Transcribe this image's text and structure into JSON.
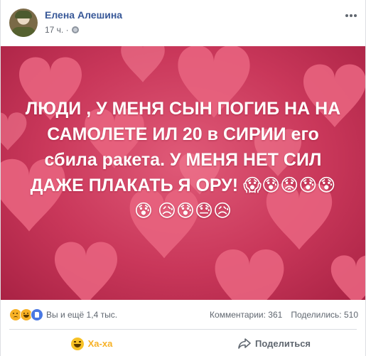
{
  "post": {
    "author": "Елена Алешина",
    "time": "17 ч. ·",
    "text": "ЛЮДИ , У МЕНЯ СЫН ПОГИБ НА НА САМОЛЕТЕ ИЛ 20 в СИРИИ его сбила ракета. У МЕНЯ НЕТ СИЛ ДАЖЕ ПЛАКАТЬ Я ОРУ! 😱😰😟😰😰😰 😥😰😓😥"
  },
  "stats": {
    "reactions_text": "Вы и ещё 1,4 тыс.",
    "comments": "Комментарии: 361",
    "shares": "Поделились: 510"
  },
  "actions": {
    "reaction_label": "Ха-ха",
    "share_label": "Поделиться"
  },
  "icons": {
    "privacy": "globe-icon",
    "more": "more-options-icon",
    "reactions": [
      "sad-reaction-icon",
      "haha-reaction-icon",
      "like-reaction-icon"
    ],
    "share": "share-arrow-icon"
  },
  "colors": {
    "author_link": "#385898",
    "haha_accent": "#f7b125",
    "background_red": "#c9375a"
  }
}
